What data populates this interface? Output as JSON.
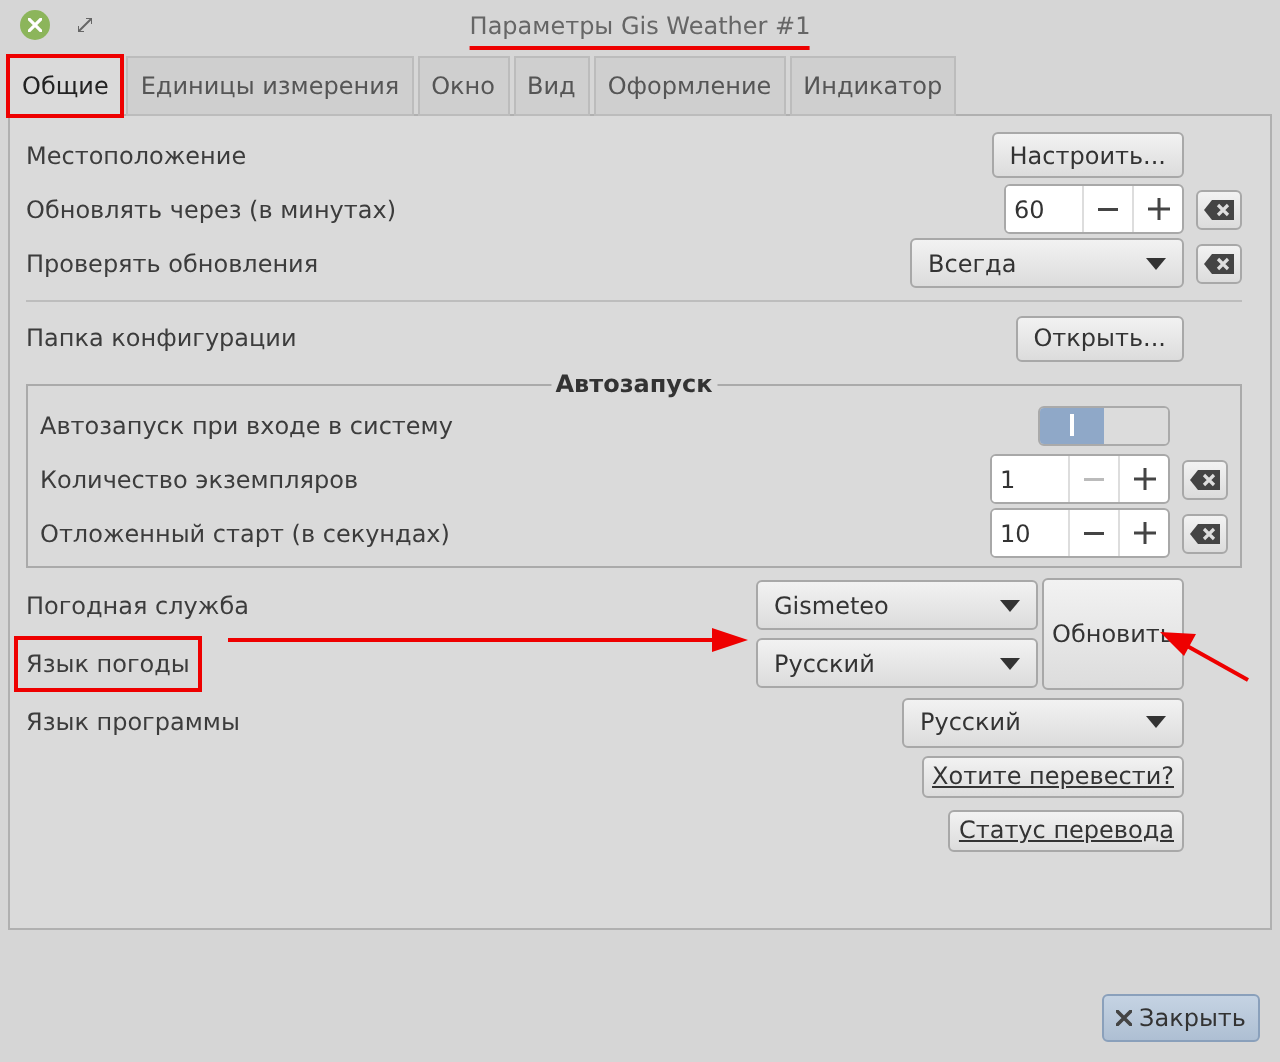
{
  "window": {
    "title": "Параметры Gis Weather #1",
    "title_underlined": true
  },
  "tabs": [
    {
      "label": "Общие",
      "selected": true,
      "highlighted": true
    },
    {
      "label": "Единицы измерения",
      "selected": false,
      "highlighted": false
    },
    {
      "label": "Окно",
      "selected": false,
      "highlighted": false
    },
    {
      "label": "Вид",
      "selected": false,
      "highlighted": false
    },
    {
      "label": "Оформление",
      "selected": false,
      "highlighted": false
    },
    {
      "label": "Индикатор",
      "selected": false,
      "highlighted": false
    }
  ],
  "general": [
    {
      "kind": "button",
      "label": "Местоположение",
      "button": "Настроить..."
    },
    {
      "kind": "spin",
      "label": "Обновлять через (в минутах)",
      "value": "60",
      "min_reached": false
    },
    {
      "kind": "select",
      "label": "Проверять обновления",
      "value": "Всегда"
    }
  ],
  "config": {
    "label": "Папка конфигурации",
    "button": "Открыть..."
  },
  "autostart": {
    "title": "Автозапуск",
    "rows": [
      {
        "kind": "switch",
        "label": "Автозапуск при входе в систему",
        "on": true
      },
      {
        "kind": "spin",
        "label": "Количество экземпляров",
        "value": "1",
        "min_reached": true
      },
      {
        "kind": "spin",
        "label": "Отложенный старт (в секундах)",
        "value": "10",
        "min_reached": false
      }
    ]
  },
  "weather": {
    "service": {
      "label": "Погодная служба",
      "value": "Gismeteo"
    },
    "language": {
      "label": "Язык погоды",
      "value": "Русский",
      "highlighted": true
    },
    "refresh_button": "Обновить"
  },
  "program_language": {
    "label": "Язык программы",
    "value": "Русский"
  },
  "links": [
    "Хотите перевести?",
    "Статус перевода"
  ],
  "close_button": "Закрыть"
}
